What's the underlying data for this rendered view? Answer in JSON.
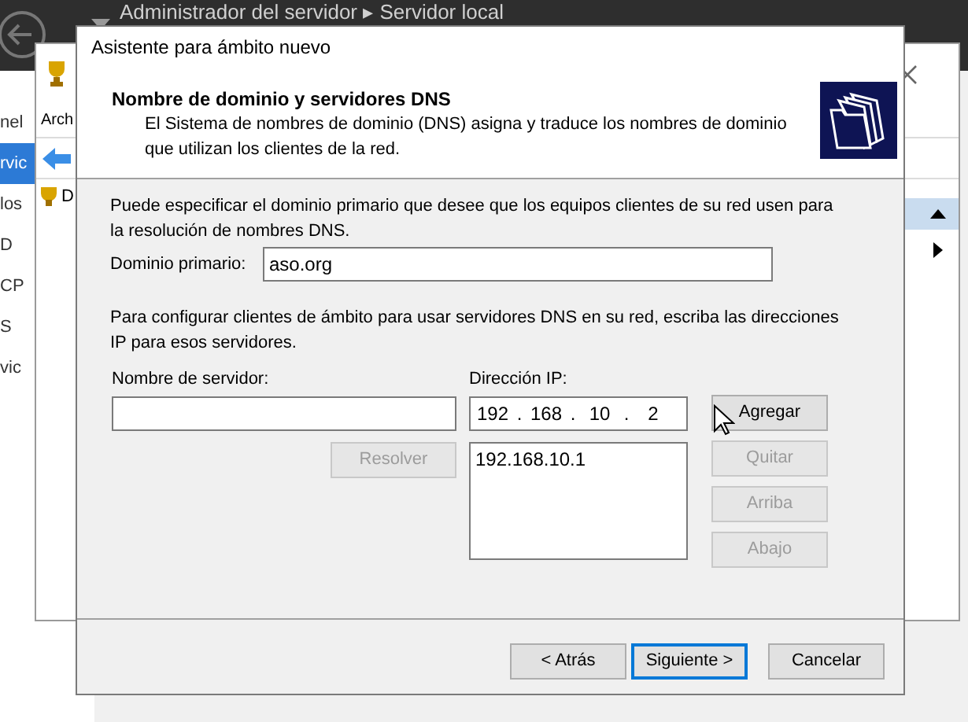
{
  "server_manager": {
    "title": "Administrador del servidor ▸ Servidor local",
    "sidebar_items": [
      {
        "label": "nel",
        "selected": false
      },
      {
        "label": "rvic",
        "selected": true
      },
      {
        "label": "los",
        "selected": false
      },
      {
        "label": "D",
        "selected": false
      },
      {
        "label": "CP",
        "selected": false
      },
      {
        "label": "S",
        "selected": false
      },
      {
        "label": "vic",
        "selected": false
      }
    ]
  },
  "console": {
    "menu": [
      "Arch"
    ],
    "tree": [
      {
        "label": "D"
      }
    ]
  },
  "dialog": {
    "title": "Asistente para ámbito nuevo",
    "header": {
      "title": "Nombre de dominio y servidores DNS",
      "description": "El Sistema de nombres de dominio (DNS) asigna y traduce los nombres de dominio que utilizan los clientes de la red."
    },
    "intro": "Puede especificar el dominio primario que desee que los equipos clientes de su red usen para la resolución de nombres DNS.",
    "primary_domain": {
      "label": "Dominio primario:",
      "value": "aso.org"
    },
    "dns_intro": "Para configurar clientes de ámbito para usar servidores DNS en su red, escriba las direcciones IP para esos servidores.",
    "server_name": {
      "label": "Nombre de servidor:"
    },
    "resolve_button": {
      "label": "Resolver",
      "disabled": true
    },
    "ip_address": {
      "label": "Dirección IP:",
      "octets": [
        "192",
        "168",
        "10",
        "2"
      ],
      "separator": "."
    },
    "dns_servers": [
      "192.168.10.1"
    ],
    "side_buttons": [
      {
        "label": "Agregar",
        "disabled": false
      },
      {
        "label": "Quitar",
        "disabled": true
      },
      {
        "label": "Arriba",
        "disabled": true
      },
      {
        "label": "Abajo",
        "disabled": true
      }
    ],
    "footer_buttons": [
      {
        "label": "< Atrás",
        "default": false
      },
      {
        "label": "Siguiente >",
        "default": true
      },
      {
        "label": "Cancelar",
        "default": false
      }
    ]
  }
}
